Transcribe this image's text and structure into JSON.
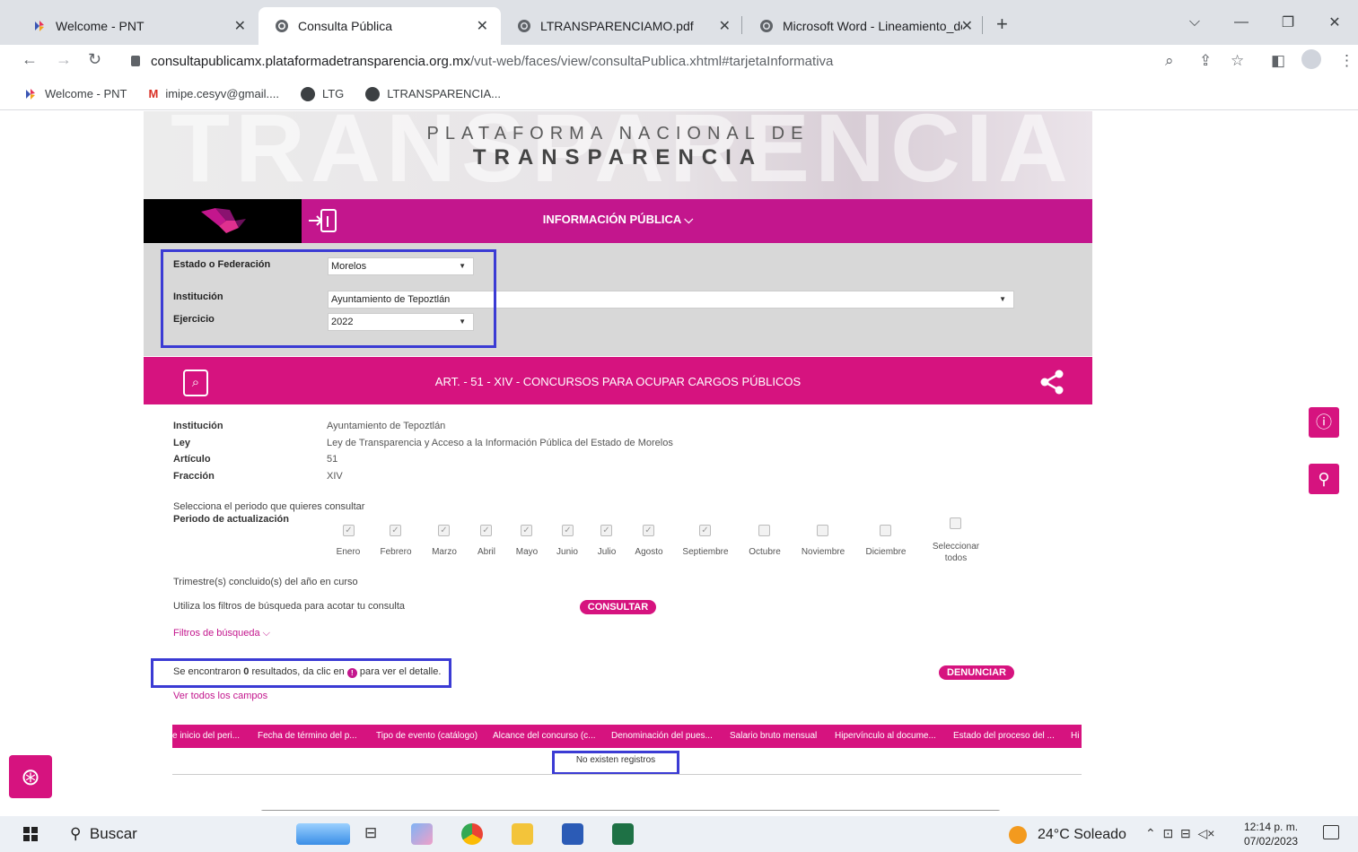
{
  "browser": {
    "tabs": [
      {
        "title": "Welcome - PNT",
        "active": false
      },
      {
        "title": "Consulta Pública",
        "active": true
      },
      {
        "title": "LTRANSPARENCIAMO.pdf",
        "active": false
      },
      {
        "title": "Microsoft Word - Lineamiento_de",
        "active": false
      }
    ],
    "url_host": "consultapublicamx.plataformadetransparencia.org.mx",
    "url_path": "/vut-web/faces/view/consultaPublica.xhtml#tarjetaInformativa",
    "bookmarks": [
      "Welcome - PNT",
      "imipe.cesyv@gmail....",
      "LTG",
      "LTRANSPARENCIA..."
    ]
  },
  "header": {
    "line1": "PLATAFORMA NACIONAL DE",
    "line2": "TRANSPARENCIA",
    "nav_title": "INFORMACIÓN PÚBLICA ⌵"
  },
  "filters": {
    "estado_label": "Estado o Federación",
    "estado_value": "Morelos",
    "institucion_label": "Institución",
    "institucion_value": "Ayuntamiento de Tepoztlán",
    "ejercicio_label": "Ejercicio",
    "ejercicio_value": "2022"
  },
  "article": {
    "title": "ART. - 51 - XIV - CONCURSOS PARA OCUPAR CARGOS PÚBLICOS"
  },
  "info": [
    {
      "label": "Institución",
      "value": "Ayuntamiento de Tepoztlán"
    },
    {
      "label": "Ley",
      "value": "Ley de Transparencia y Acceso a la Información Pública del Estado de Morelos"
    },
    {
      "label": "Artículo",
      "value": "51"
    },
    {
      "label": "Fracción",
      "value": "XIV"
    }
  ],
  "periodo": {
    "intro": "Selecciona el periodo que quieres consultar",
    "label": "Periodo de actualización",
    "months": [
      {
        "name": "Enero",
        "checked": true
      },
      {
        "name": "Febrero",
        "checked": true
      },
      {
        "name": "Marzo",
        "checked": true
      },
      {
        "name": "Abril",
        "checked": true
      },
      {
        "name": "Mayo",
        "checked": true
      },
      {
        "name": "Junio",
        "checked": true
      },
      {
        "name": "Julio",
        "checked": true
      },
      {
        "name": "Agosto",
        "checked": true
      },
      {
        "name": "Septiembre",
        "checked": true
      },
      {
        "name": "Octubre",
        "checked": false
      },
      {
        "name": "Noviembre",
        "checked": false
      },
      {
        "name": "Diciembre",
        "checked": false
      }
    ],
    "select_all_line1": "Seleccionar",
    "select_all_line2": "todos",
    "trimestre": "Trimestre(s) concluido(s) del año en curso",
    "filtros_hint": "Utiliza los filtros de búsqueda para acotar tu consulta",
    "consultar": "CONSULTAR",
    "filtros_link": "Filtros de búsqueda ⌵"
  },
  "results": {
    "prefix": "Se encontraron ",
    "count": "0",
    "middle": " resultados, da clic en ",
    "suffix": " para ver el detalle.",
    "denunciar": "DENUNCIAR",
    "ver_todos": "Ver todos los campos",
    "no_records": "No existen registros"
  },
  "table": {
    "columns": [
      "e inicio del peri...",
      "Fecha de término del p...",
      "Tipo de evento (catálogo)",
      "Alcance del concurso (c...",
      "Denominación del pues...",
      "Salario bruto mensual",
      "Hipervínculo al docume...",
      "Estado del proceso del ...",
      "Hi"
    ]
  },
  "taskbar": {
    "search": "Buscar",
    "weather": "24°C  Soleado",
    "time": "12:14 p. m.",
    "date": "07/02/2023"
  },
  "colors": {
    "magenta": "#d6137f",
    "highlight": "#3b3bd4"
  }
}
